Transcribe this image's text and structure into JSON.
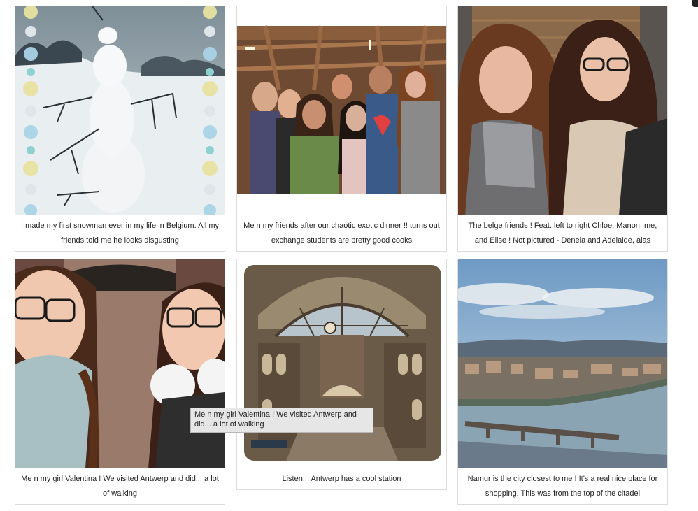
{
  "gallery": {
    "items": [
      {
        "caption": "I made my first snowman ever in my life in Belgium. All my friends told me he looks disgusting",
        "image": "snowman-photo"
      },
      {
        "caption": "Me n my friends after our chaotic exotic dinner !! turns out exchange students are pretty good cooks",
        "image": "group-photo"
      },
      {
        "caption": "The belge friends ! Feat. left to right Chloe, Manon, me, and Elise ! Not pictured - Denela and Adelaide, alas",
        "image": "selfie-photo"
      },
      {
        "caption": "Me n my girl Valentina ! We visited Antwerp and did... a lot of walking",
        "image": "valentina-photo"
      },
      {
        "caption": "Listen... Antwerp has a cool station",
        "image": "antwerp-station-photo"
      },
      {
        "caption": "Namur is the city closest to me ! It's a real nice place for shopping. This was from the top of the citadel",
        "image": "namur-photo"
      }
    ]
  },
  "tooltip": {
    "text": "Me n my girl Valentina ! We visited Antwerp and did... a lot of walking"
  },
  "colors": {
    "border": "#dcdcdc",
    "caption_text": "#222222",
    "tooltip_bg": "#e6e6e6"
  }
}
